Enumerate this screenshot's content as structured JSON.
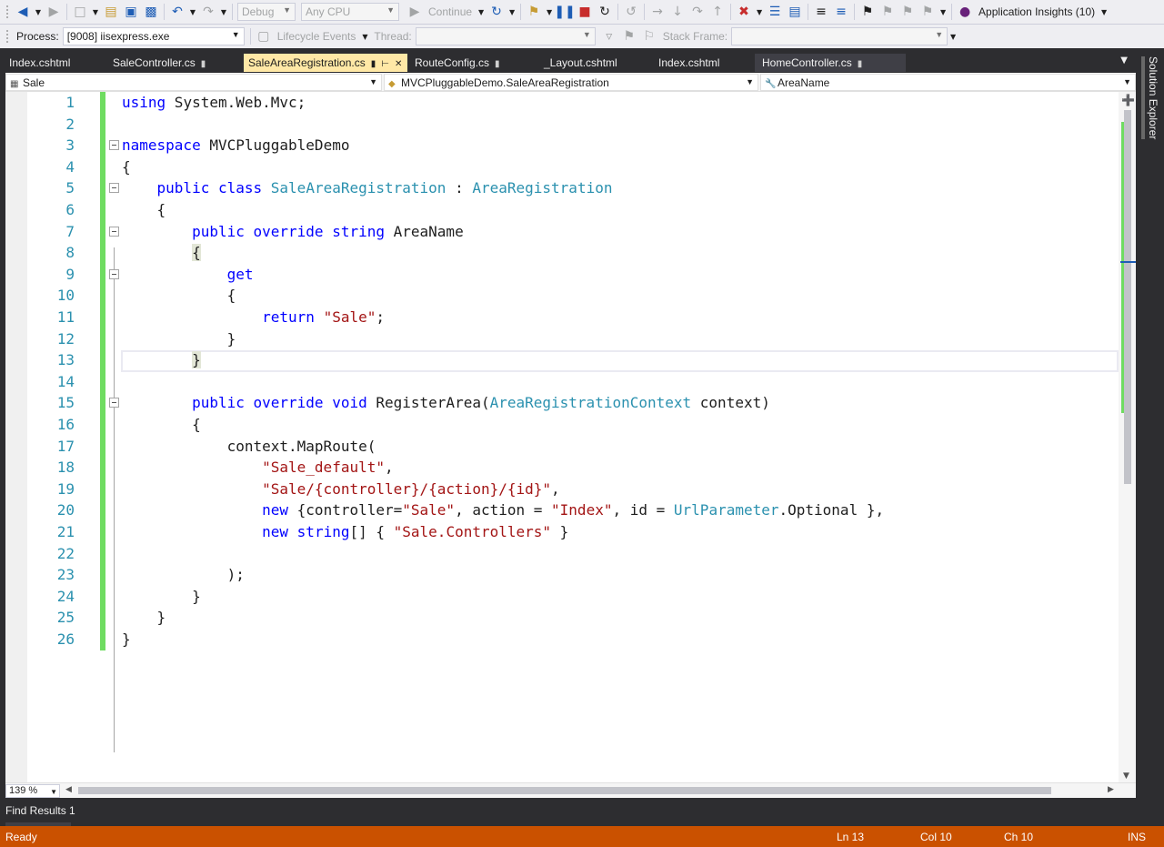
{
  "toolbar": {
    "config": "Debug",
    "platform": "Any CPU",
    "continue_label": "Continue",
    "insights_label": "Application Insights (10)"
  },
  "debug_toolbar": {
    "process_label": "Process:",
    "process_value": "[9008] iisexpress.exe",
    "lifecycle_label": "Lifecycle Events",
    "thread_label": "Thread:",
    "stack_frame_label": "Stack Frame:"
  },
  "tabs": [
    {
      "label": "Index.cshtml",
      "pinned": false,
      "active": false
    },
    {
      "label": "SaleController.cs",
      "pinned": true,
      "active": false
    },
    {
      "label": "SaleAreaRegistration.cs",
      "pinned": true,
      "active": true
    },
    {
      "label": "RouteConfig.cs",
      "pinned": true,
      "active": false
    },
    {
      "label": "_Layout.cshtml",
      "pinned": false,
      "active": false
    },
    {
      "label": "Index.cshtml",
      "pinned": false,
      "active": false
    },
    {
      "label": "HomeController.cs",
      "pinned": true,
      "active": false
    }
  ],
  "side_panel": {
    "label": "Solution Explorer"
  },
  "navbar": {
    "project": "Sale",
    "type": "MVCPluggableDemo.SaleAreaRegistration",
    "member": "AreaName"
  },
  "code_lines": [
    {
      "n": "1"
    },
    {
      "n": "2"
    },
    {
      "n": "3"
    },
    {
      "n": "4"
    },
    {
      "n": "5"
    },
    {
      "n": "6"
    },
    {
      "n": "7"
    },
    {
      "n": "8"
    },
    {
      "n": "9"
    },
    {
      "n": "10"
    },
    {
      "n": "11"
    },
    {
      "n": "12"
    },
    {
      "n": "13"
    },
    {
      "n": "14"
    },
    {
      "n": "15"
    },
    {
      "n": "16"
    },
    {
      "n": "17"
    },
    {
      "n": "18"
    },
    {
      "n": "19"
    },
    {
      "n": "20"
    },
    {
      "n": "21"
    },
    {
      "n": "22"
    },
    {
      "n": "23"
    },
    {
      "n": "24"
    },
    {
      "n": "25"
    },
    {
      "n": "26"
    }
  ],
  "code": {
    "l1": [
      "using",
      " System.Web.Mvc;"
    ],
    "l3": [
      "namespace",
      " MVCPluggableDemo"
    ],
    "l4": "{",
    "l5": [
      "    ",
      "public",
      " ",
      "class",
      " ",
      "SaleAreaRegistration",
      " : ",
      "AreaRegistration"
    ],
    "l6": "    {",
    "l7": [
      "        ",
      "public",
      " ",
      "override",
      " ",
      "string",
      " AreaName"
    ],
    "l8": "{",
    "l9": [
      "            ",
      "get"
    ],
    "l10": "            {",
    "l11": [
      "                ",
      "return",
      " ",
      "\"Sale\"",
      ";"
    ],
    "l12": "            }",
    "l13": "}",
    "l15": [
      "        ",
      "public",
      " ",
      "override",
      " ",
      "void",
      " RegisterArea(",
      "AreaRegistrationContext",
      " context)"
    ],
    "l16": "        {",
    "l17": "            context.MapRoute(",
    "l18": [
      "                ",
      "\"Sale_default\"",
      ","
    ],
    "l19": [
      "                ",
      "\"Sale/{controller}/{action}/{id}\"",
      ","
    ],
    "l20": [
      "                ",
      "new",
      " {controller=",
      "\"Sale\"",
      ", action = ",
      "\"Index\"",
      ", id = ",
      "UrlParameter",
      ".Optional },"
    ],
    "l21": [
      "                ",
      "new",
      " ",
      "string",
      "[] { ",
      "\"Sale.Controllers\"",
      " }"
    ],
    "l23": "            );",
    "l24": "        }",
    "l25": "    }",
    "l26": "}"
  },
  "zoom": "139 %",
  "find_results": "Find Results 1",
  "status": {
    "text": "Ready",
    "ln": "Ln 13",
    "col": "Col 10",
    "ch": "Ch 10",
    "mode": "INS"
  },
  "colors": {
    "status_bar": "#ca5100",
    "active_tab": "#ffe8a6",
    "keyword": "#0000ff",
    "type": "#2b91af",
    "string": "#a31515"
  }
}
